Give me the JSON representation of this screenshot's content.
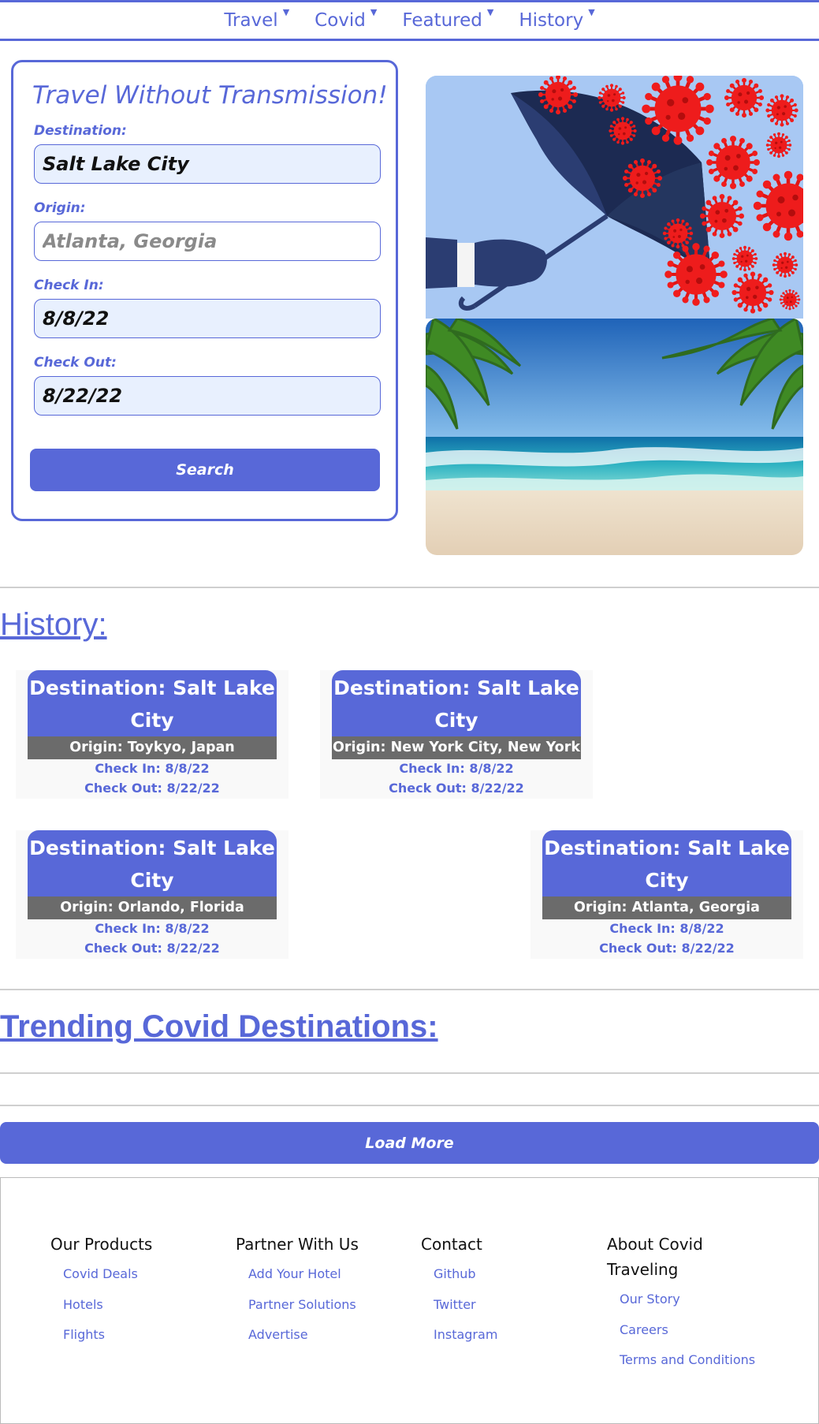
{
  "nav": {
    "items": [
      "Travel",
      "Covid",
      "Featured",
      "History"
    ]
  },
  "search": {
    "title": "Travel Without Transmission!",
    "destination_label": "Destination:",
    "destination_value": "Salt Lake City",
    "origin_label": "Origin:",
    "origin_placeholder": "Atlanta, Georgia",
    "checkin_label": "Check In:",
    "checkin_value": "8/8/22",
    "checkout_label": "Check Out:",
    "checkout_value": "8/22/22",
    "button_label": "Search"
  },
  "history": {
    "title": "History:",
    "cards": [
      {
        "destination": "Destination: Salt Lake City",
        "origin": "Origin: Toykyo, Japan",
        "check_in": "Check In: 8/8/22",
        "check_out": "Check Out: 8/22/22"
      },
      {
        "destination": "Destination: Salt Lake City",
        "origin": "Origin: New York City, New York",
        "check_in": "Check In: 8/8/22",
        "check_out": "Check Out: 8/22/22"
      },
      {
        "destination": "Destination: Salt Lake City",
        "origin": "Origin: Orlando, Florida",
        "check_in": "Check In: 8/8/22",
        "check_out": "Check Out: 8/22/22"
      },
      {
        "destination": "Destination: Salt Lake City",
        "origin": "Origin: Atlanta, Georgia",
        "check_in": "Check In: 8/8/22",
        "check_out": "Check Out: 8/22/22"
      }
    ]
  },
  "trending": {
    "title": "Trending Covid Destinations:"
  },
  "load_more_label": "Load More",
  "footer": {
    "columns": [
      {
        "heading": "Our Products",
        "links": [
          "Covid Deals",
          "Hotels",
          "Flights"
        ]
      },
      {
        "heading": "Partner With Us",
        "links": [
          "Add Your Hotel",
          "Partner Solutions",
          "Advertise"
        ]
      },
      {
        "heading": "Contact",
        "links": [
          "Github",
          "Twitter",
          "Instagram"
        ]
      },
      {
        "heading": "About Covid Traveling",
        "links": [
          "Our Story",
          "Careers",
          "Terms and Conditions"
        ]
      }
    ]
  },
  "colors": {
    "brand": "#5868d8",
    "origin_bar": "#6b6b6b",
    "virus": "#ee1c1c",
    "sky": "#a8c8f3"
  },
  "icons": [
    "dropdown-caret-icon"
  ]
}
